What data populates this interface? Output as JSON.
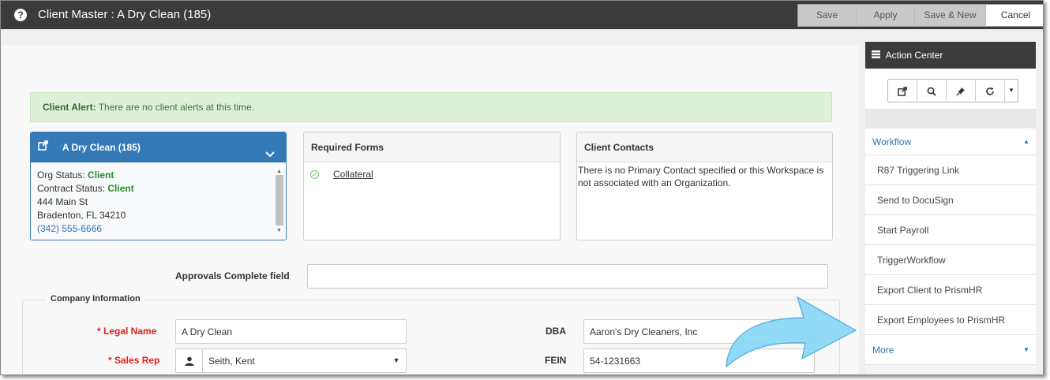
{
  "window": {
    "title": "Client Master : A Dry Clean (185)",
    "buttons": {
      "save": "Save",
      "apply": "Apply",
      "save_new": "Save & New",
      "cancel": "Cancel"
    }
  },
  "alert": {
    "label": "Client Alert:",
    "text": "There are no client alerts at this time."
  },
  "org_panel": {
    "title": "A Dry Clean (185)",
    "org_status_label": "Org Status:",
    "org_status": "Client",
    "contract_status_label": "Contract Status:",
    "contract_status": "Client",
    "address1": "444 Main St",
    "address2": "Bradenton, FL 34210",
    "phone": "(342) 555-6666"
  },
  "required_forms": {
    "title": "Required Forms",
    "items": [
      "Collateral"
    ]
  },
  "client_contacts": {
    "title": "Client Contacts",
    "text": "There is no Primary Contact specified or this Workspace is not associated with an Organization."
  },
  "approvals": {
    "label": "Approvals Complete field",
    "value": ""
  },
  "company_info": {
    "legend": "Company Information",
    "legal_name_label": "* Legal Name",
    "legal_name": "A Dry Clean",
    "sales_rep_label": "* Sales Rep",
    "sales_rep": "Seith, Kent",
    "dba_label": "DBA",
    "dba": "Aaron's Dry Cleaners, Inc",
    "fein_label": "FEIN",
    "fein": "54-1231663"
  },
  "action_center": {
    "title": "Action Center",
    "section": "Workflow",
    "items": [
      "R87 Triggering Link",
      "Send to DocuSign",
      "Start Payroll",
      "TriggerWorkflow",
      "Export Client to PrismHR",
      "Export Employees to PrismHR"
    ],
    "more": "More"
  },
  "colors": {
    "accent": "#337ab7",
    "alert_bg": "#dff0d8",
    "required": "#d9231e",
    "arrow": "#7fd3f2"
  }
}
